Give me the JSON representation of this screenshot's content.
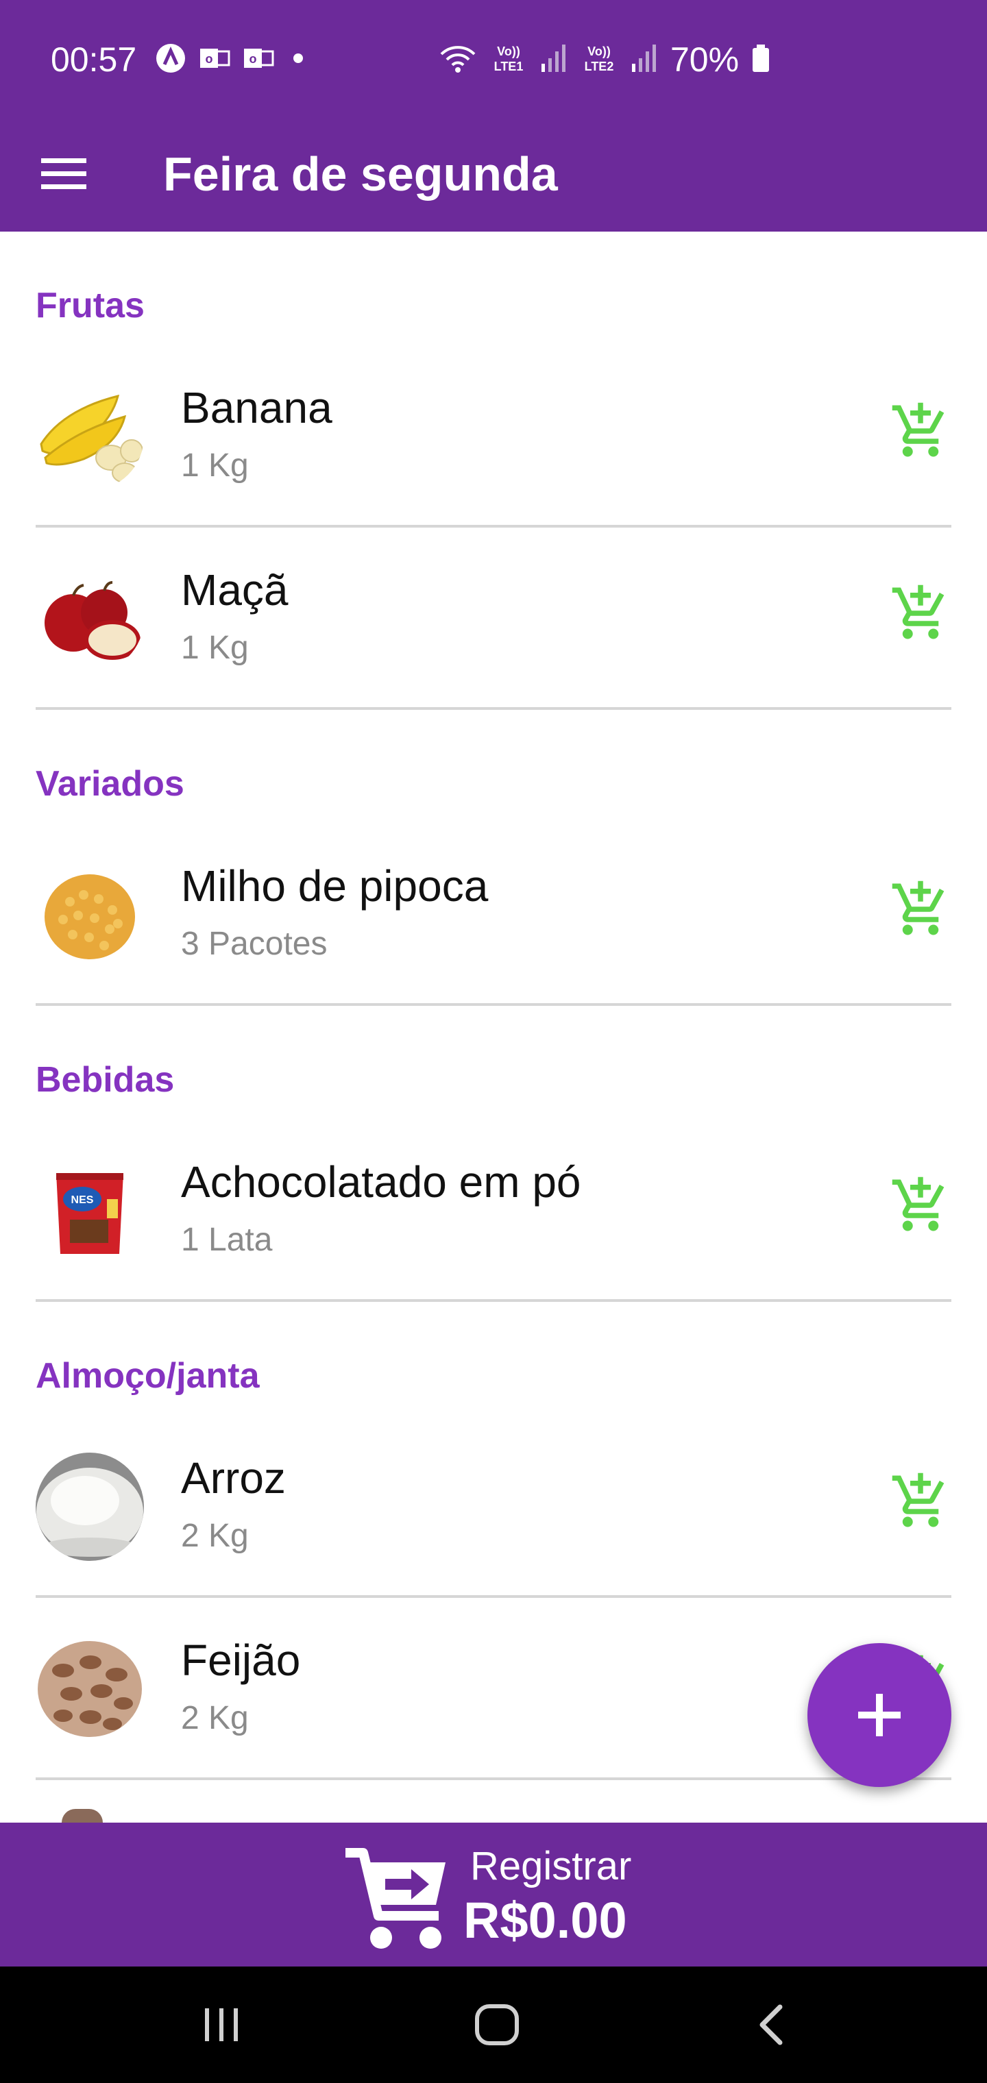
{
  "status_bar": {
    "time": "00:57",
    "battery": "70%",
    "icons": [
      "navigation-arrow-icon",
      "outlook-icon",
      "outlook-icon",
      "notification-dot",
      "wifi-icon",
      "volte-lte1-icon",
      "signal-icon",
      "volte-lte2-icon",
      "signal-icon",
      "battery-icon"
    ],
    "volte1": "Vo)) LTE1",
    "volte2": "Vo)) LTE2"
  },
  "app_bar": {
    "title": "Feira de segunda",
    "menu_icon": "hamburger-menu-icon"
  },
  "sections": [
    {
      "header": "Frutas",
      "items": [
        {
          "name": "Banana",
          "qty": "1 Kg",
          "thumb": "banana"
        },
        {
          "name": "Maçã",
          "qty": "1 Kg",
          "thumb": "apple"
        }
      ]
    },
    {
      "header": "Variados",
      "items": [
        {
          "name": "Milho de pipoca",
          "qty": "3 Pacotes",
          "thumb": "popcorn"
        }
      ]
    },
    {
      "header": "Bebidas",
      "items": [
        {
          "name": "Achocolatado em pó",
          "qty": "1 Lata",
          "thumb": "chocolate-powder"
        }
      ]
    },
    {
      "header": "Almoço/janta",
      "items": [
        {
          "name": "Arroz",
          "qty": "2 Kg",
          "thumb": "rice"
        },
        {
          "name": "Feijão",
          "qty": "2 Kg",
          "thumb": "beans"
        }
      ]
    }
  ],
  "fab": {
    "icon": "plus-icon"
  },
  "register": {
    "label": "Registrar",
    "total": "R$0.00",
    "icon": "cart-arrow-icon"
  },
  "nav": {
    "recents_icon": "recents-icon",
    "home_icon": "home-icon",
    "back_icon": "back-icon"
  },
  "colors": {
    "primary": "#6c2a9a",
    "accent": "#8533c0",
    "cart_green": "#5dd44a",
    "qty_gray": "#8a8a8a"
  }
}
